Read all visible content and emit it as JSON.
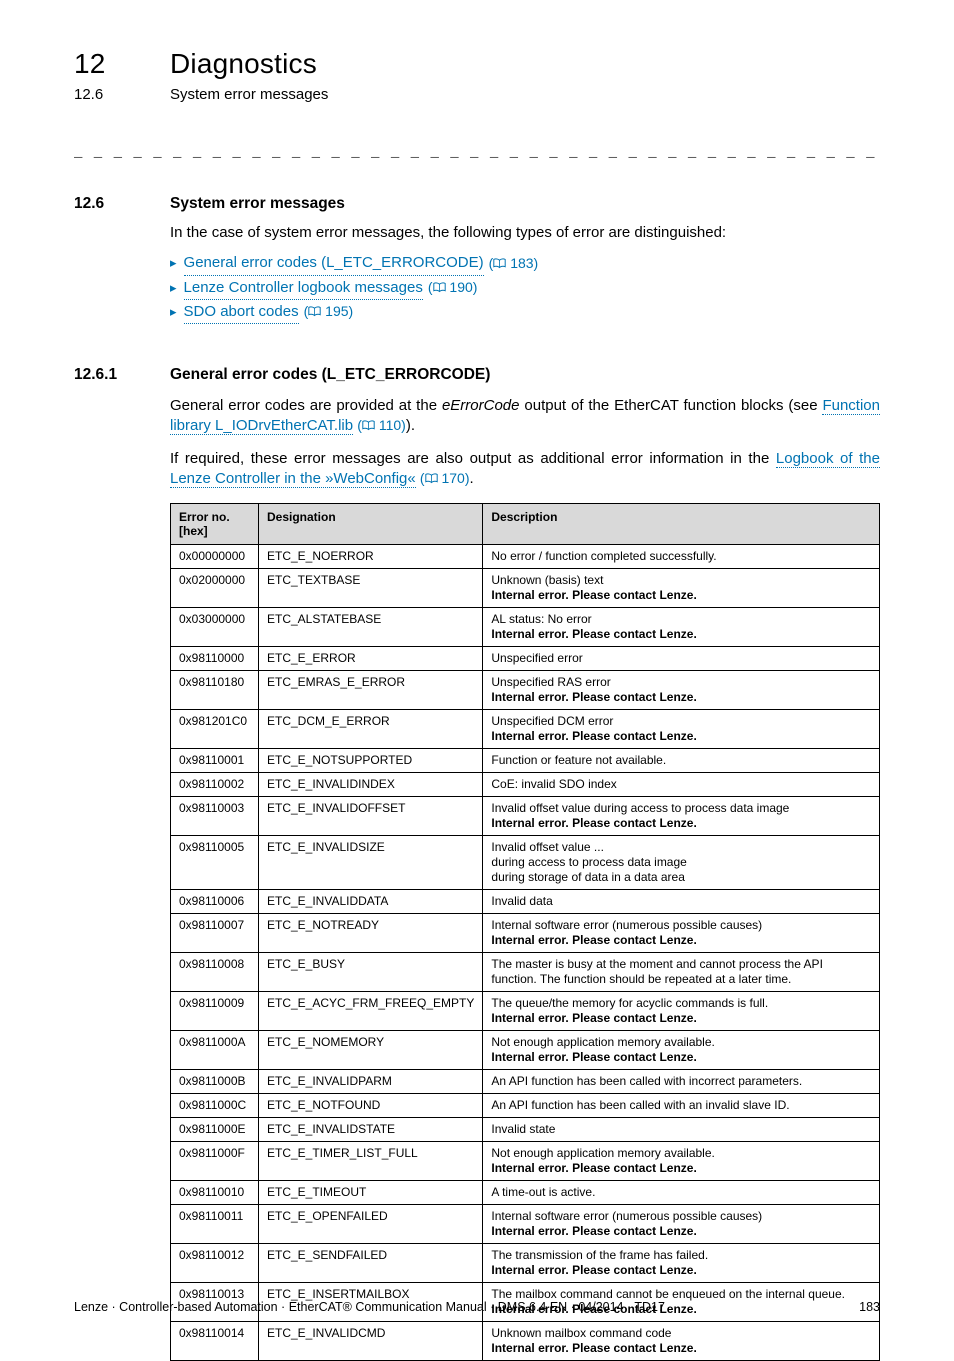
{
  "header": {
    "chapter_num": "12",
    "chapter_title": "Diagnostics",
    "section_num": "12.6",
    "section_title": "System error messages"
  },
  "dash_rule": "_ _ _ _ _ _ _ _ _ _ _ _ _ _ _ _ _ _ _ _ _ _ _ _ _ _ _ _ _ _ _ _ _ _ _ _ _ _ _ _ _ _ _ _ _ _ _ _ _ _ _ _ _ _ _ _ _ _ _ _ _ _ _ _",
  "section_12_6": {
    "num": "12.6",
    "title": "System error messages",
    "intro": "In the case of system error messages, the following types of error are distinguished:",
    "bullets": [
      {
        "text": "General error codes (L_ETC_ERRORCODE)",
        "ref": "183"
      },
      {
        "text": "Lenze Controller logbook messages",
        "ref": "190"
      },
      {
        "text": "SDO abort codes",
        "ref": "195"
      }
    ]
  },
  "section_12_6_1": {
    "num": "12.6.1",
    "title": "General error codes (L_ETC_ERRORCODE)",
    "para1_a": "General error codes are provided at the ",
    "para1_em": "eErrorCode",
    "para1_b": " output of the EtherCAT function blocks (see ",
    "para1_link": "Function library L_IODrvEtherCAT.lib",
    "para1_ref": "110",
    "para1_c": ").",
    "para2_a": "If required, these error messages are also output as additional error information in the ",
    "para2_link": "Logbook of the Lenze Controller in the »WebConfig«",
    "para2_ref": "170",
    "para2_c": "."
  },
  "table": {
    "headers": {
      "errno": "Error no. [hex]",
      "desig": "Designation",
      "desc": "Description"
    },
    "rows": [
      {
        "errno": "0x00000000",
        "desig": "ETC_E_NOERROR",
        "desc_lines": [
          "No error / function completed successfully."
        ],
        "bold_from": null
      },
      {
        "errno": "0x02000000",
        "desig": "ETC_TEXTBASE",
        "desc_lines": [
          "Unknown (basis) text",
          "Internal error. Please contact Lenze."
        ],
        "bold_from": 1
      },
      {
        "errno": "0x03000000",
        "desig": "ETC_ALSTATEBASE",
        "desc_lines": [
          "AL status: No error",
          "Internal error. Please contact Lenze."
        ],
        "bold_from": 1
      },
      {
        "errno": "0x98110000",
        "desig": "ETC_E_ERROR",
        "desc_lines": [
          "Unspecified error"
        ],
        "bold_from": null
      },
      {
        "errno": "0x98110180",
        "desig": "ETC_EMRAS_E_ERROR",
        "desc_lines": [
          "Unspecified RAS error",
          "Internal error. Please contact Lenze."
        ],
        "bold_from": 1
      },
      {
        "errno": "0x981201C0",
        "desig": "ETC_DCM_E_ERROR",
        "desc_lines": [
          "Unspecified DCM error",
          "Internal error. Please contact Lenze."
        ],
        "bold_from": 1
      },
      {
        "errno": "0x98110001",
        "desig": "ETC_E_NOTSUPPORTED",
        "desc_lines": [
          "Function or feature not available."
        ],
        "bold_from": null
      },
      {
        "errno": "0x98110002",
        "desig": "ETC_E_INVALIDINDEX",
        "desc_lines": [
          "CoE: invalid SDO index"
        ],
        "bold_from": null
      },
      {
        "errno": "0x98110003",
        "desig": "ETC_E_INVALIDOFFSET",
        "desc_lines": [
          "Invalid offset value during access to process data image",
          "Internal error. Please contact Lenze."
        ],
        "bold_from": 1
      },
      {
        "errno": "0x98110005",
        "desig": "ETC_E_INVALIDSIZE",
        "desc_lines": [
          "Invalid offset value ...",
          "during access to process data image",
          "during storage of data in a data area"
        ],
        "bold_from": null
      },
      {
        "errno": "0x98110006",
        "desig": "ETC_E_INVALIDDATA",
        "desc_lines": [
          "Invalid data"
        ],
        "bold_from": null
      },
      {
        "errno": "0x98110007",
        "desig": "ETC_E_NOTREADY",
        "desc_lines": [
          "Internal software error (numerous possible causes)",
          "Internal error. Please contact Lenze."
        ],
        "bold_from": 1
      },
      {
        "errno": "0x98110008",
        "desig": "ETC_E_BUSY",
        "desc_lines": [
          "The master is busy at the moment and cannot process the API function. The function should be repeated at a later time."
        ],
        "bold_from": null
      },
      {
        "errno": "0x98110009",
        "desig": "ETC_E_ACYC_FRM_FREEQ_EMPTY",
        "desc_lines": [
          "The queue/the memory for acyclic commands is full.",
          "Internal error. Please contact Lenze."
        ],
        "bold_from": 1
      },
      {
        "errno": "0x9811000A",
        "desig": "ETC_E_NOMEMORY",
        "desc_lines": [
          "Not enough application memory available.",
          "Internal error. Please contact Lenze."
        ],
        "bold_from": 1
      },
      {
        "errno": "0x9811000B",
        "desig": "ETC_E_INVALIDPARM",
        "desc_lines": [
          "An API function has been called with incorrect parameters."
        ],
        "bold_from": null
      },
      {
        "errno": "0x9811000C",
        "desig": "ETC_E_NOTFOUND",
        "desc_lines": [
          "An API function has been called with an invalid slave ID."
        ],
        "bold_from": null
      },
      {
        "errno": "0x9811000E",
        "desig": "ETC_E_INVALIDSTATE",
        "desc_lines": [
          "Invalid state"
        ],
        "bold_from": null
      },
      {
        "errno": "0x9811000F",
        "desig": "ETC_E_TIMER_LIST_FULL",
        "desc_lines": [
          "Not enough application memory available.",
          "Internal error. Please contact Lenze."
        ],
        "bold_from": 1
      },
      {
        "errno": "0x98110010",
        "desig": "ETC_E_TIMEOUT",
        "desc_lines": [
          "A time-out is active."
        ],
        "bold_from": null
      },
      {
        "errno": "0x98110011",
        "desig": "ETC_E_OPENFAILED",
        "desc_lines": [
          "Internal software error (numerous possible causes)",
          "Internal error. Please contact Lenze."
        ],
        "bold_from": 1
      },
      {
        "errno": "0x98110012",
        "desig": "ETC_E_SENDFAILED",
        "desc_lines": [
          "The transmission of the frame has failed.",
          "Internal error. Please contact Lenze."
        ],
        "bold_from": 1
      },
      {
        "errno": "0x98110013",
        "desig": "ETC_E_INSERTMAILBOX",
        "desc_lines": [
          "The mailbox command cannot be enqueued on the internal queue.",
          "Internal error. Please contact Lenze."
        ],
        "bold_from": 1
      },
      {
        "errno": "0x98110014",
        "desig": "ETC_E_INVALIDCMD",
        "desc_lines": [
          "Unknown mailbox command code",
          "Internal error. Please contact Lenze."
        ],
        "bold_from": 1
      }
    ]
  },
  "footer": {
    "left": "Lenze · Controller-based Automation · EtherCAT® Communication Manual · DMS 6.4 EN · 04/2014 · TD17",
    "right": "183"
  }
}
